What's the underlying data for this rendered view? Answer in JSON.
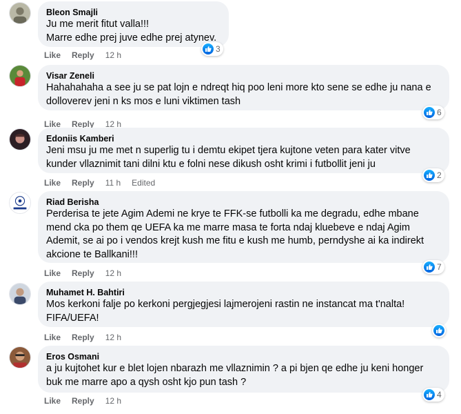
{
  "colors": {
    "bubble_bg": "#f0f2f5",
    "action_text": "#65676b",
    "like_blue": "#0866ff"
  },
  "comments": [
    {
      "author": "Bleon Smajli",
      "text": "Ju me merit fitut valla!!!\nMarre edhe prej juve edhe prej atynev.",
      "like": "Like",
      "reply": "Reply",
      "time": "12 h",
      "edited": "",
      "reactions": "3"
    },
    {
      "author": "Visar Zeneli",
      "text": "Hahahahaha a see ju se pat lojn e ndreqt hiq poo leni more kto sene se edhe ju nana e\ndolloverev jeni n ks mos e luni viktimen tash",
      "like": "Like",
      "reply": "Reply",
      "time": "12 h",
      "edited": "",
      "reactions": "6"
    },
    {
      "author": "Edoniis Kamberi",
      "text": "Jeni msu ju me met n superlig tu i demtu ekipet tjera kujtone veten para kater vitve\nkunder vllaznimit tani dilni ktu e folni nese dikush osht krimi i futbollit jeni ju",
      "like": "Like",
      "reply": "Reply",
      "time": "11 h",
      "edited": "Edited",
      "reactions": "2"
    },
    {
      "author": "Riad Berisha",
      "text": "Perderisa te jete Agim Ademi ne krye te FFK-se futbolli ka me degradu, edhe mbane\nmend cka po them qe UEFA ka me marre masa te forta ndaj kluebeve e ndaj Agim\nAdemit, se ai po i vendos krejt kush me fitu e kush me humb, perndyshe ai ka indirekt\nakcione te Ballkani!!!",
      "like": "Like",
      "reply": "Reply",
      "time": "12 h",
      "edited": "",
      "reactions": "7"
    },
    {
      "author": "Muhamet H. Bahtiri",
      "text": "Mos kerkoni falje po kerkoni pergjegjesi lajmerojeni rastin ne instancat ma t'nalta!\nFIFA/UEFA!",
      "like": "Like",
      "reply": "Reply",
      "time": "12 h",
      "edited": "",
      "reactions": ""
    },
    {
      "author": "Eros Osmani",
      "text": "a ju kujtohet kur e blet lojen nbarazh me vllaznimin ? a pi bjen qe edhe ju keni honger\nbuk me marre apo a qysh osht kjo pun tash ?",
      "like": "Like",
      "reply": "Reply",
      "time": "12 h",
      "edited": "",
      "reactions": "4"
    }
  ]
}
